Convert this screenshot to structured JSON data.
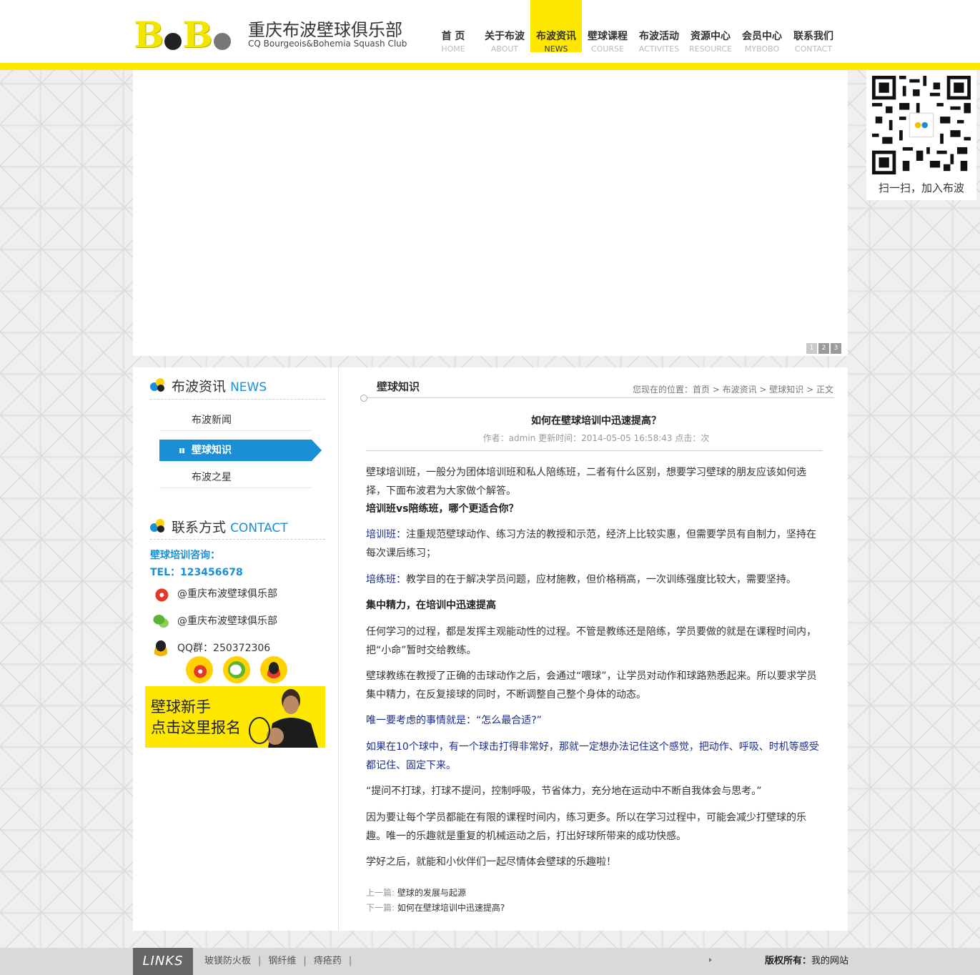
{
  "brand": {
    "logo_text": "BoBo",
    "title": "重庆布波壁球俱乐部",
    "subtitle": "CQ Bourgeois&Bohemia Squash Club"
  },
  "nav": [
    {
      "cn": "首 页",
      "en": "HOME",
      "active": false
    },
    {
      "cn": "关于布波",
      "en": "ABOUT",
      "active": false
    },
    {
      "cn": "布波资讯",
      "en": "NEWS",
      "active": true
    },
    {
      "cn": "壁球课程",
      "en": "COURSE",
      "active": false
    },
    {
      "cn": "布波活动",
      "en": "ACTIVITES",
      "active": false
    },
    {
      "cn": "资源中心",
      "en": "RESOURCE",
      "active": false
    },
    {
      "cn": "会员中心",
      "en": "MYBOBO",
      "active": false
    },
    {
      "cn": "联系我们",
      "en": "CONTACT",
      "active": false
    }
  ],
  "banner": {
    "pager": [
      "1",
      "2",
      "3"
    ],
    "qr_caption": "扫一扫，加入布波"
  },
  "sidebar": {
    "news_title_cn": "布波资讯",
    "news_title_en": "NEWS",
    "items": [
      {
        "label": "布波新闻",
        "active": false
      },
      {
        "label": "壁球知识",
        "active": true
      },
      {
        "label": "布波之星",
        "active": false
      }
    ],
    "contact_title_cn": "联系方式",
    "contact_title_en": "CONTACT",
    "consult_label": "壁球培训咨询：",
    "tel": "TEL：123456678",
    "weibo": "@重庆布波壁球俱乐部",
    "wechat": "@重庆布波壁球俱乐部",
    "qq": "QQ群：250372306",
    "signup_line1": "壁球新手",
    "signup_line2": "点击这里报名"
  },
  "main": {
    "section_title": "壁球知识",
    "breadcrumb": "您现在的位置：首页 > 布波资讯 > 壁球知识 > 正文",
    "article_title": "如何在壁球培训中迅速提高？",
    "meta": "作者：admin   更新时间：2014-05-05 16:58:43   点击：次",
    "paragraphs": {
      "p1": "壁球培训班，一般分为团体培训班和私人陪练班，二者有什么区别，想要学习壁球的朋友应该如何选择，下面布波君为大家做个解答。",
      "p2": "培训班vs陪练班，哪个更适合你？",
      "p3_label": "培训班：",
      "p3": "注重规范壁球动作、练习方法的教授和示范，经济上比较实惠，但需要学员有自制力，坚持在每次课后练习；",
      "p4_label": "培练班：",
      "p4": "教学目的在于解决学员问题，应材施教，但价格稍高，一次训练强度比较大，需要坚持。",
      "p5": "集中精力，在培训中迅速提高",
      "p6": "任何学习的过程，都是发挥主观能动性的过程。不管是教练还是陪练，学员要做的就是在课程时间内，把“小命”暂时交给教练。",
      "p7": "壁球教练在教授了正确的击球动作之后，会通过“喂球”，让学员对动作和球路熟悉起来。所以要求学员集中精力，在反复接球的同时，不断调整自己整个身体的动态。",
      "p8": "唯一要考虑的事情就是：“怎么最合适?”",
      "p9": "如果在10个球中，有一个球击打得非常好，那就一定想办法记住这个感觉，把动作、呼吸、时机等感受都记住、固定下来。",
      "p10": "“提问不打球，打球不提问，控制呼吸，节省体力，充分地在运动中不断自我体会与思考。”",
      "p11": "因为要让每个学员都能在有限的课程时间内，练习更多。所以在学习过程中，可能会减少打壁球的乐趣。唯一的乐趣就是重复的机械运动之后，打出好球所带来的成功快感。",
      "p12": "学好之后，就能和小伙伴们一起尽情体会壁球的乐趣啦！"
    },
    "prev_label": "上一篇:",
    "prev_link": "壁球的发展与起源",
    "next_label": "下一篇:",
    "next_link": "如何在壁球培训中迅速提高?"
  },
  "footer": {
    "links_tag": "LINKS",
    "links": [
      "玻镁防火板",
      "钢纤维",
      "痔疮药"
    ],
    "sep": "|",
    "copyright_label": "版权所有：",
    "copyright_value": "我的网站"
  },
  "colors": {
    "brand_yellow": "#ffe800",
    "accent_blue": "#1a8fd6",
    "text_blue": "#1a2c8a"
  }
}
